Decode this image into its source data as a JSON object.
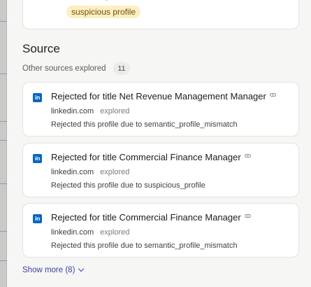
{
  "top_card": {
    "chip_label": "suspicious profile"
  },
  "source": {
    "title": "Source",
    "explored_label": "Other sources explored",
    "explored_count": "11",
    "items": [
      {
        "title": "Rejected for title Net Revenue Management Manager",
        "domain": "linkedin.com",
        "status": "explored",
        "reason": "Rejected this profile due to semantic_profile_mismatch",
        "icon": "linkedin-icon"
      },
      {
        "title": "Rejected for title Commercial Finance Manager",
        "domain": "linkedin.com",
        "status": "explored",
        "reason": "Rejected this profile due to suspicious_profile",
        "icon": "linkedin-icon"
      },
      {
        "title": "Rejected for title Commercial Finance Manager",
        "domain": "linkedin.com",
        "status": "explored",
        "reason": "Rejected this profile due to semantic_profile_mismatch",
        "icon": "linkedin-icon"
      }
    ],
    "show_more_label": "Show more (8)"
  },
  "colors": {
    "chip_bg": "#fbefc3",
    "linkedin_blue": "#0a66c2",
    "link_accent": "#3f3fa8"
  }
}
